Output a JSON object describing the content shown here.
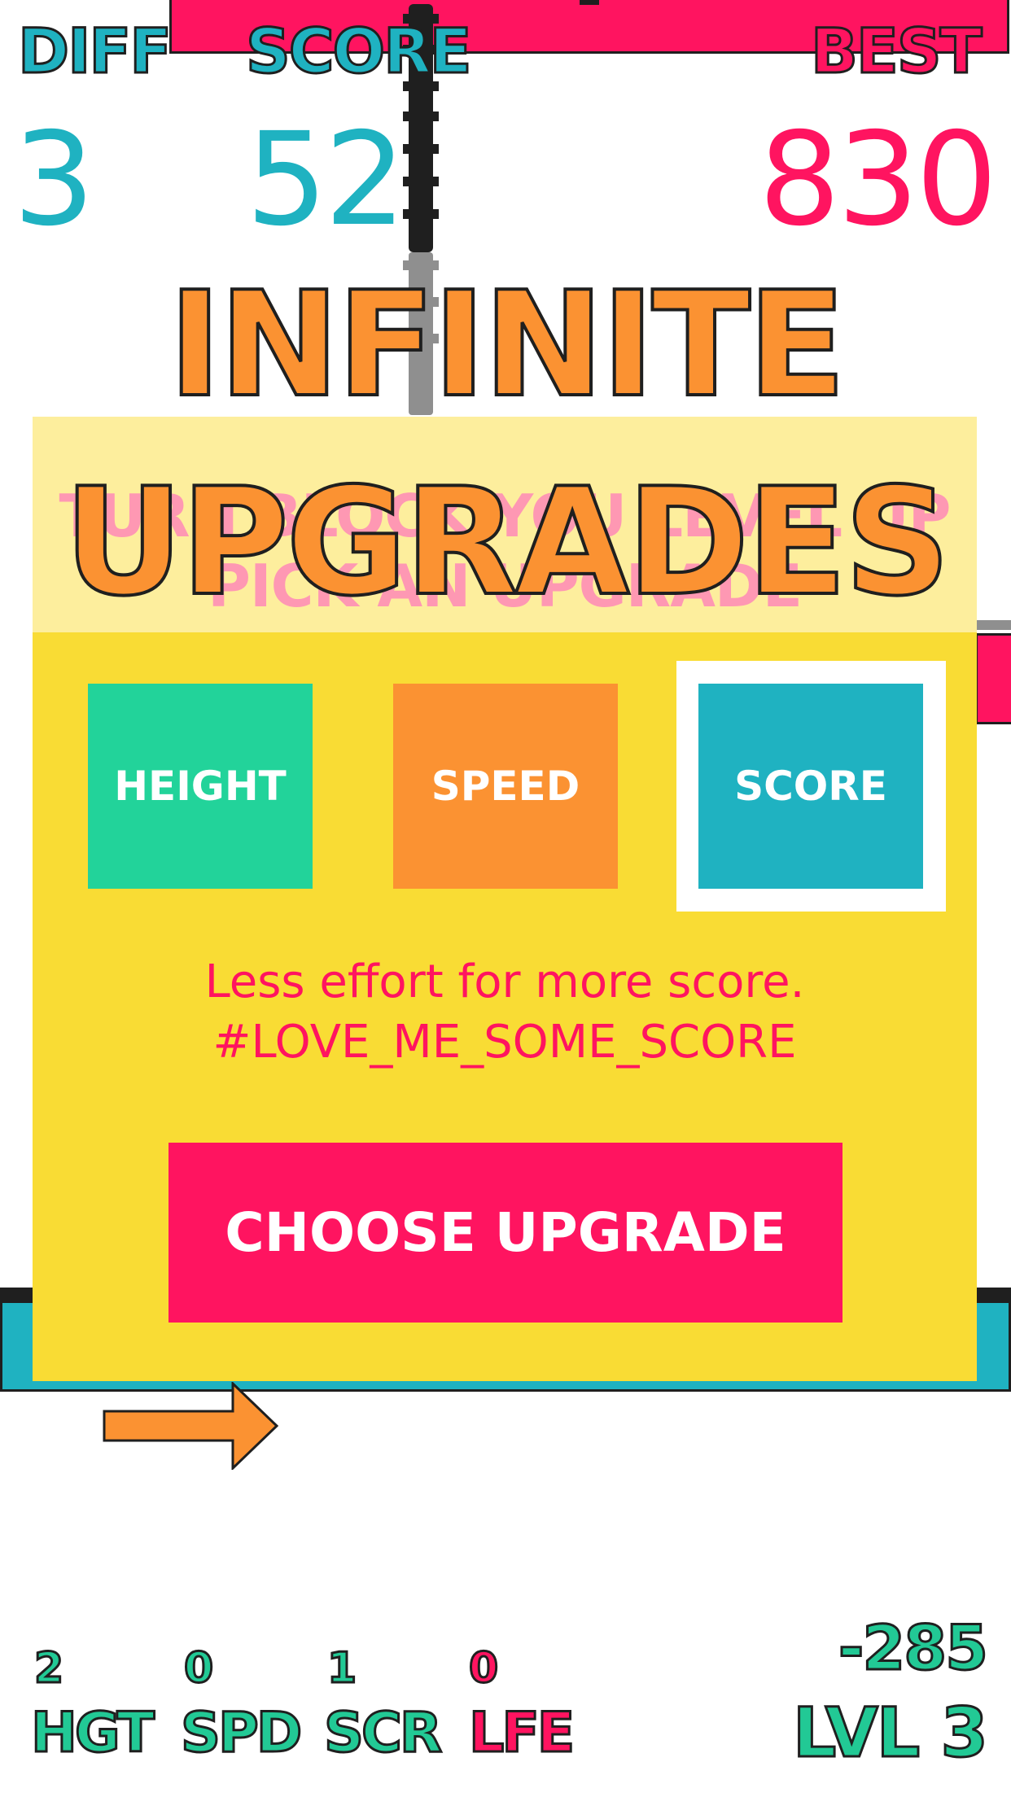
{
  "hud": {
    "diff_label": "DIFF",
    "diff_value": "3",
    "score_label": "SCORE",
    "score_value": "52",
    "best_label": "BEST",
    "best_value": "830"
  },
  "overlay": {
    "title_line1": "INFINITE",
    "title_line2": "UPGRADES",
    "faded_line1": "TURN BLOCK YOU LEVEL UP",
    "faded_line2": "PICK AN UPGRADE"
  },
  "upgrades": [
    {
      "label": "HEIGHT",
      "color": "#22d39a"
    },
    {
      "label": "SPEED",
      "color": "#fb9232"
    },
    {
      "label": "SCORE",
      "color": "#1fb2c1",
      "selected": true
    }
  ],
  "description": {
    "line1": "Less effort for more score.",
    "line2": "#LOVE_ME_SOME_SCORE"
  },
  "choose_button": "CHOOSE UPGRADE",
  "stats": [
    {
      "value": "2",
      "label": "HGT",
      "color": "#22c995"
    },
    {
      "value": "0",
      "label": "SPD",
      "color": "#22c995"
    },
    {
      "value": "1",
      "label": "SCR",
      "color": "#22c995"
    },
    {
      "value": "0",
      "label": "LFE",
      "color": "#ff1460"
    }
  ],
  "bottom_right": {
    "offset": "-285",
    "level": "LVL 3"
  },
  "colors": {
    "pink": "#ff1460",
    "teal": "#1fb2c1",
    "orange": "#fb9232",
    "green": "#22c995",
    "yellow": "#f9dc34"
  },
  "icons": {
    "arrow": "right-arrow-icon"
  }
}
